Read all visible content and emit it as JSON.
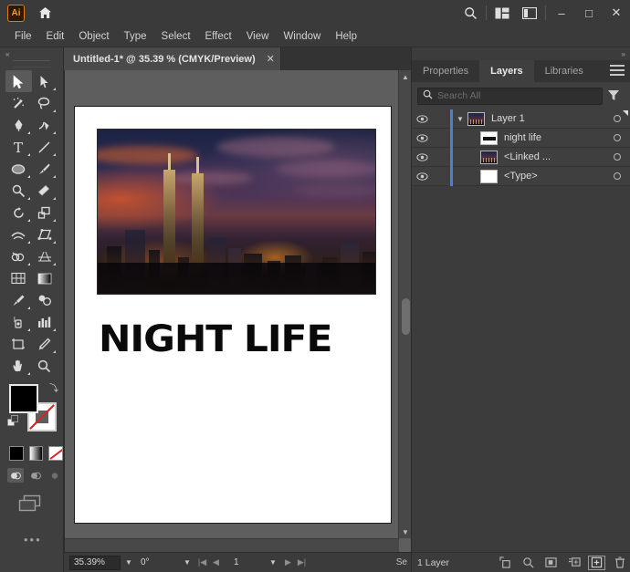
{
  "app": {
    "name": "Adobe Illustrator",
    "logo_text": "Ai",
    "home_icon": "home-icon",
    "search_icon": "search-icon",
    "arrange_icon": "arrange-documents-icon",
    "workspace_icon": "workspace-switcher-icon",
    "minimize": "–",
    "maximize": "□",
    "close": "✕"
  },
  "menubar": {
    "items": [
      "File",
      "Edit",
      "Object",
      "Type",
      "Select",
      "Effect",
      "View",
      "Window",
      "Help"
    ]
  },
  "document": {
    "tab_title": "Untitled-1* @ 35.39 % (CMYK/Preview)",
    "close_label": "✕"
  },
  "artwork": {
    "headline": "NIGHT LIFE",
    "image_description": "Kuala Lumpur skyline at dusk with Petronas Towers"
  },
  "toolbar": {
    "collapse_label": "«",
    "tools": [
      {
        "name": "selection-tool",
        "active": true
      },
      {
        "name": "direct-selection-tool",
        "active": false
      },
      {
        "name": "magic-wand-tool",
        "active": false
      },
      {
        "name": "lasso-tool",
        "active": false
      },
      {
        "name": "pen-tool",
        "active": false
      },
      {
        "name": "curvature-tool",
        "active": false
      },
      {
        "name": "type-tool",
        "active": false
      },
      {
        "name": "line-segment-tool",
        "active": false
      },
      {
        "name": "ellipse-tool",
        "active": false
      },
      {
        "name": "paintbrush-tool",
        "active": false
      },
      {
        "name": "shaper-tool",
        "active": false
      },
      {
        "name": "eraser-tool",
        "active": false
      },
      {
        "name": "rotate-tool",
        "active": false
      },
      {
        "name": "scale-tool",
        "active": false
      },
      {
        "name": "width-tool",
        "active": false
      },
      {
        "name": "free-transform-tool",
        "active": false
      },
      {
        "name": "shape-builder-tool",
        "active": false
      },
      {
        "name": "gradient-tool",
        "active": false
      },
      {
        "name": "eyedropper-tool",
        "active": false
      },
      {
        "name": "blend-tool",
        "active": false
      },
      {
        "name": "symbol-sprayer-tool",
        "active": false
      },
      {
        "name": "column-graph-tool",
        "active": false
      },
      {
        "name": "artboard-tool",
        "active": false
      },
      {
        "name": "slice-tool",
        "active": false
      },
      {
        "name": "hand-tool",
        "active": false
      },
      {
        "name": "zoom-tool",
        "active": false
      }
    ],
    "fill_color": "#000000",
    "stroke_color": "none",
    "more_tools_label": "•••"
  },
  "statusbar": {
    "zoom": "35.39%",
    "rotation": "0°",
    "page": "1",
    "tail_text": "Se"
  },
  "panels": {
    "expand_label": "»",
    "tabs": [
      {
        "label": "Properties",
        "active": false
      },
      {
        "label": "Layers",
        "active": true
      },
      {
        "label": "Libraries",
        "active": false
      }
    ],
    "menu_icon": "panel-menu-icon"
  },
  "search": {
    "value": "",
    "placeholder": "Search All",
    "icon": "search-icon",
    "filter_icon": "filter-icon"
  },
  "layers": {
    "rows": [
      {
        "name": "Layer 1",
        "type": "layer",
        "indent": 0,
        "expanded": true,
        "visible": true,
        "selected": true,
        "thumb": "city",
        "color": "#4b7fd4"
      },
      {
        "name": "night life",
        "type": "text-group",
        "indent": 1,
        "expanded": false,
        "visible": true,
        "selected": false,
        "thumb": "text",
        "color": "#4b7fd4"
      },
      {
        "name": "<Linked ...",
        "type": "linked-image",
        "indent": 1,
        "expanded": false,
        "visible": true,
        "selected": false,
        "thumb": "city",
        "color": "#4b7fd4"
      },
      {
        "name": "<Type>",
        "type": "type-object",
        "indent": 1,
        "expanded": false,
        "visible": true,
        "selected": false,
        "thumb": "blank",
        "color": "#4b7fd4"
      }
    ],
    "footer": {
      "count_label": "1 Layer",
      "buttons": [
        {
          "name": "release-to-layers-button",
          "selected": false
        },
        {
          "name": "locate-object-button",
          "selected": false
        },
        {
          "name": "make-clipping-mask-button",
          "selected": false
        },
        {
          "name": "create-new-sublayer-button",
          "selected": false
        },
        {
          "name": "create-new-layer-button",
          "selected": true
        },
        {
          "name": "delete-selection-button",
          "selected": false
        }
      ]
    }
  }
}
